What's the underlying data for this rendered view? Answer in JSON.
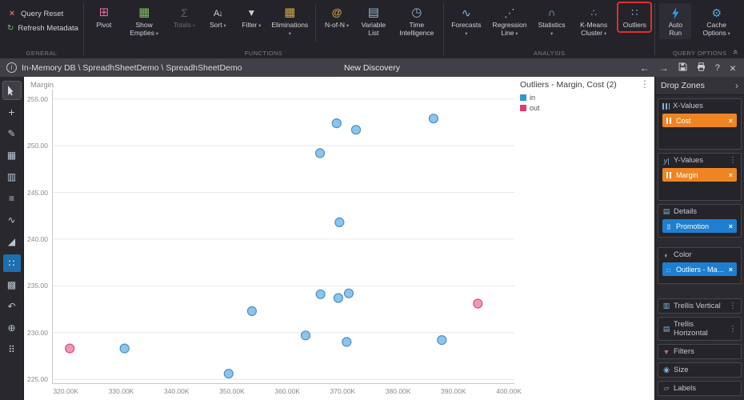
{
  "ribbon": {
    "general": {
      "label": "GENERAL",
      "items": [
        {
          "label": "Query Reset",
          "icon": "x-icon"
        },
        {
          "label": "Refresh Metadata",
          "icon": "refresh-icon"
        }
      ]
    },
    "functions": {
      "label": "FUNCTIONS",
      "items": [
        {
          "label": "Pivot",
          "icon": "pivot-grid-icon"
        },
        {
          "label": "Show Empties",
          "icon": "grid-icon",
          "dropdown": true
        },
        {
          "label": "Totals",
          "icon": "sigma-icon",
          "dropdown": true,
          "disabled": true
        },
        {
          "label": "Sort",
          "icon": "sort-az-icon",
          "dropdown": true
        },
        {
          "label": "Filter",
          "icon": "funnel-icon",
          "dropdown": true
        },
        {
          "label": "Eliminations",
          "icon": "grid-icon",
          "dropdown": true
        },
        {
          "label": "N-of-N",
          "icon": "at-grid-icon",
          "dropdown": true
        },
        {
          "label": "Variable List",
          "icon": "list-icon"
        },
        {
          "label": "Time Intelligence",
          "icon": "clock-icon"
        }
      ]
    },
    "analysis": {
      "label": "ANALYSIS",
      "items": [
        {
          "label": "Forecasts",
          "icon": "forecast-wave-icon",
          "dropdown": true
        },
        {
          "label": "Regression Line",
          "icon": "regression-dots-icon",
          "dropdown": true
        },
        {
          "label": "Statistics",
          "icon": "bell-curve-icon",
          "dropdown": true
        },
        {
          "label": "K-Means Cluster",
          "icon": "cluster-dots-icon",
          "dropdown": true
        },
        {
          "label": "Outliers",
          "icon": "scatter-dots-icon",
          "highlighted": true
        }
      ]
    },
    "query_options": {
      "label": "QUERY OPTIONS",
      "items": [
        {
          "label": "Auto Run",
          "icon": "lightning-icon"
        },
        {
          "label": "Cache Options",
          "icon": "gear-icon",
          "dropdown": true
        }
      ]
    }
  },
  "topbar": {
    "breadcrumb": "In-Memory DB \\ SpreadhSheetDemo \\ SpreadhSheetDemo",
    "title": "New Discovery"
  },
  "chart_data": {
    "type": "scatter",
    "title": "Outliers - Margin, Cost (2)",
    "ylabel": "Margin",
    "x_units": "thousands",
    "xlim": [
      317.5,
      401
    ],
    "ylim": [
      224.5,
      256
    ],
    "grid": "horizontal-only",
    "legend_position": "right-top",
    "xticks": [
      {
        "value": 320,
        "label": "320.00K"
      },
      {
        "value": 330,
        "label": "330.00K"
      },
      {
        "value": 340,
        "label": "340.00K"
      },
      {
        "value": 350,
        "label": "350.00K"
      },
      {
        "value": 360,
        "label": "360.00K"
      },
      {
        "value": 370,
        "label": "370.00K"
      },
      {
        "value": 380,
        "label": "380.00K"
      },
      {
        "value": 390,
        "label": "390.00K"
      },
      {
        "value": 400,
        "label": "400.00K"
      }
    ],
    "yticks": [
      {
        "value": 225,
        "label": "225.00"
      },
      {
        "value": 230,
        "label": "230.00"
      },
      {
        "value": 235,
        "label": "235.00"
      },
      {
        "value": 240,
        "label": "240.00"
      },
      {
        "value": 245,
        "label": "245.00"
      },
      {
        "value": 250,
        "label": "250.00"
      },
      {
        "value": 255,
        "label": "255.00"
      }
    ],
    "legend": [
      {
        "name": "in",
        "color": "#2e95d8"
      },
      {
        "name": "out",
        "color": "#dd3d6d"
      }
    ],
    "series": [
      {
        "name": "in",
        "fill": "#8ec4ec",
        "stroke": "#4a90c8",
        "points": [
          [
            330.6,
            228.3
          ],
          [
            349.4,
            225.6
          ],
          [
            353.6,
            232.3
          ],
          [
            363.3,
            229.7
          ],
          [
            365.9,
            249.2
          ],
          [
            366.0,
            234.1
          ],
          [
            368.9,
            252.4
          ],
          [
            369.2,
            233.7
          ],
          [
            369.4,
            241.8
          ],
          [
            370.7,
            229.0
          ],
          [
            371.1,
            234.2
          ],
          [
            372.4,
            251.7
          ],
          [
            386.4,
            252.9
          ],
          [
            387.9,
            229.2
          ]
        ]
      },
      {
        "name": "out",
        "fill": "#f097b4",
        "stroke": "#d9537a",
        "points": [
          [
            320.7,
            228.3
          ],
          [
            394.4,
            233.1
          ]
        ]
      }
    ]
  },
  "drop_zones": {
    "header": "Drop Zones",
    "chip_colors": {
      "measure": "#ef8522",
      "attribute": "#1e7fd0"
    },
    "sections": [
      {
        "label": "X-Values",
        "chips": [
          {
            "label": "Cost"
          }
        ]
      },
      {
        "label": "Y-Values",
        "chips": [
          {
            "label": "Margin"
          }
        ]
      },
      {
        "label": "Details",
        "chips": [
          {
            "label": "Promotion"
          }
        ]
      },
      {
        "label": "Color",
        "chips": [
          {
            "label": "Outliers - Margin,..."
          }
        ]
      },
      {
        "label": "Trellis Vertical",
        "chips": []
      },
      {
        "label": "Trellis Horizontal",
        "chips": []
      },
      {
        "label": "Filters",
        "chips": []
      },
      {
        "label": "Size",
        "chips": []
      },
      {
        "label": "Labels",
        "chips": []
      }
    ]
  }
}
